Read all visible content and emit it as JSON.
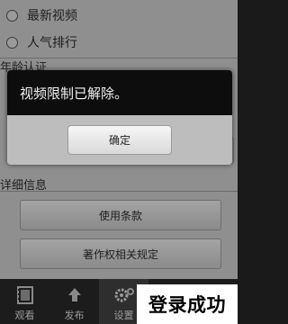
{
  "video_sort": {
    "options": [
      {
        "label": "最新视频"
      },
      {
        "label": "人气排行"
      }
    ]
  },
  "age_section": {
    "title": "年龄认证"
  },
  "dialog": {
    "message": "视频限制已解除。",
    "ok_label": "确定"
  },
  "details_section": {
    "title": "详细信息",
    "terms_label": "使用条款",
    "copyright_label": "著作权相关规定"
  },
  "tabbar": {
    "tabs": [
      {
        "label": "观看",
        "icon": "film-icon"
      },
      {
        "label": "发布",
        "icon": "upload-icon"
      },
      {
        "label": "设置",
        "icon": "gear-icon"
      }
    ]
  },
  "overlay": {
    "text": "登录成功"
  }
}
